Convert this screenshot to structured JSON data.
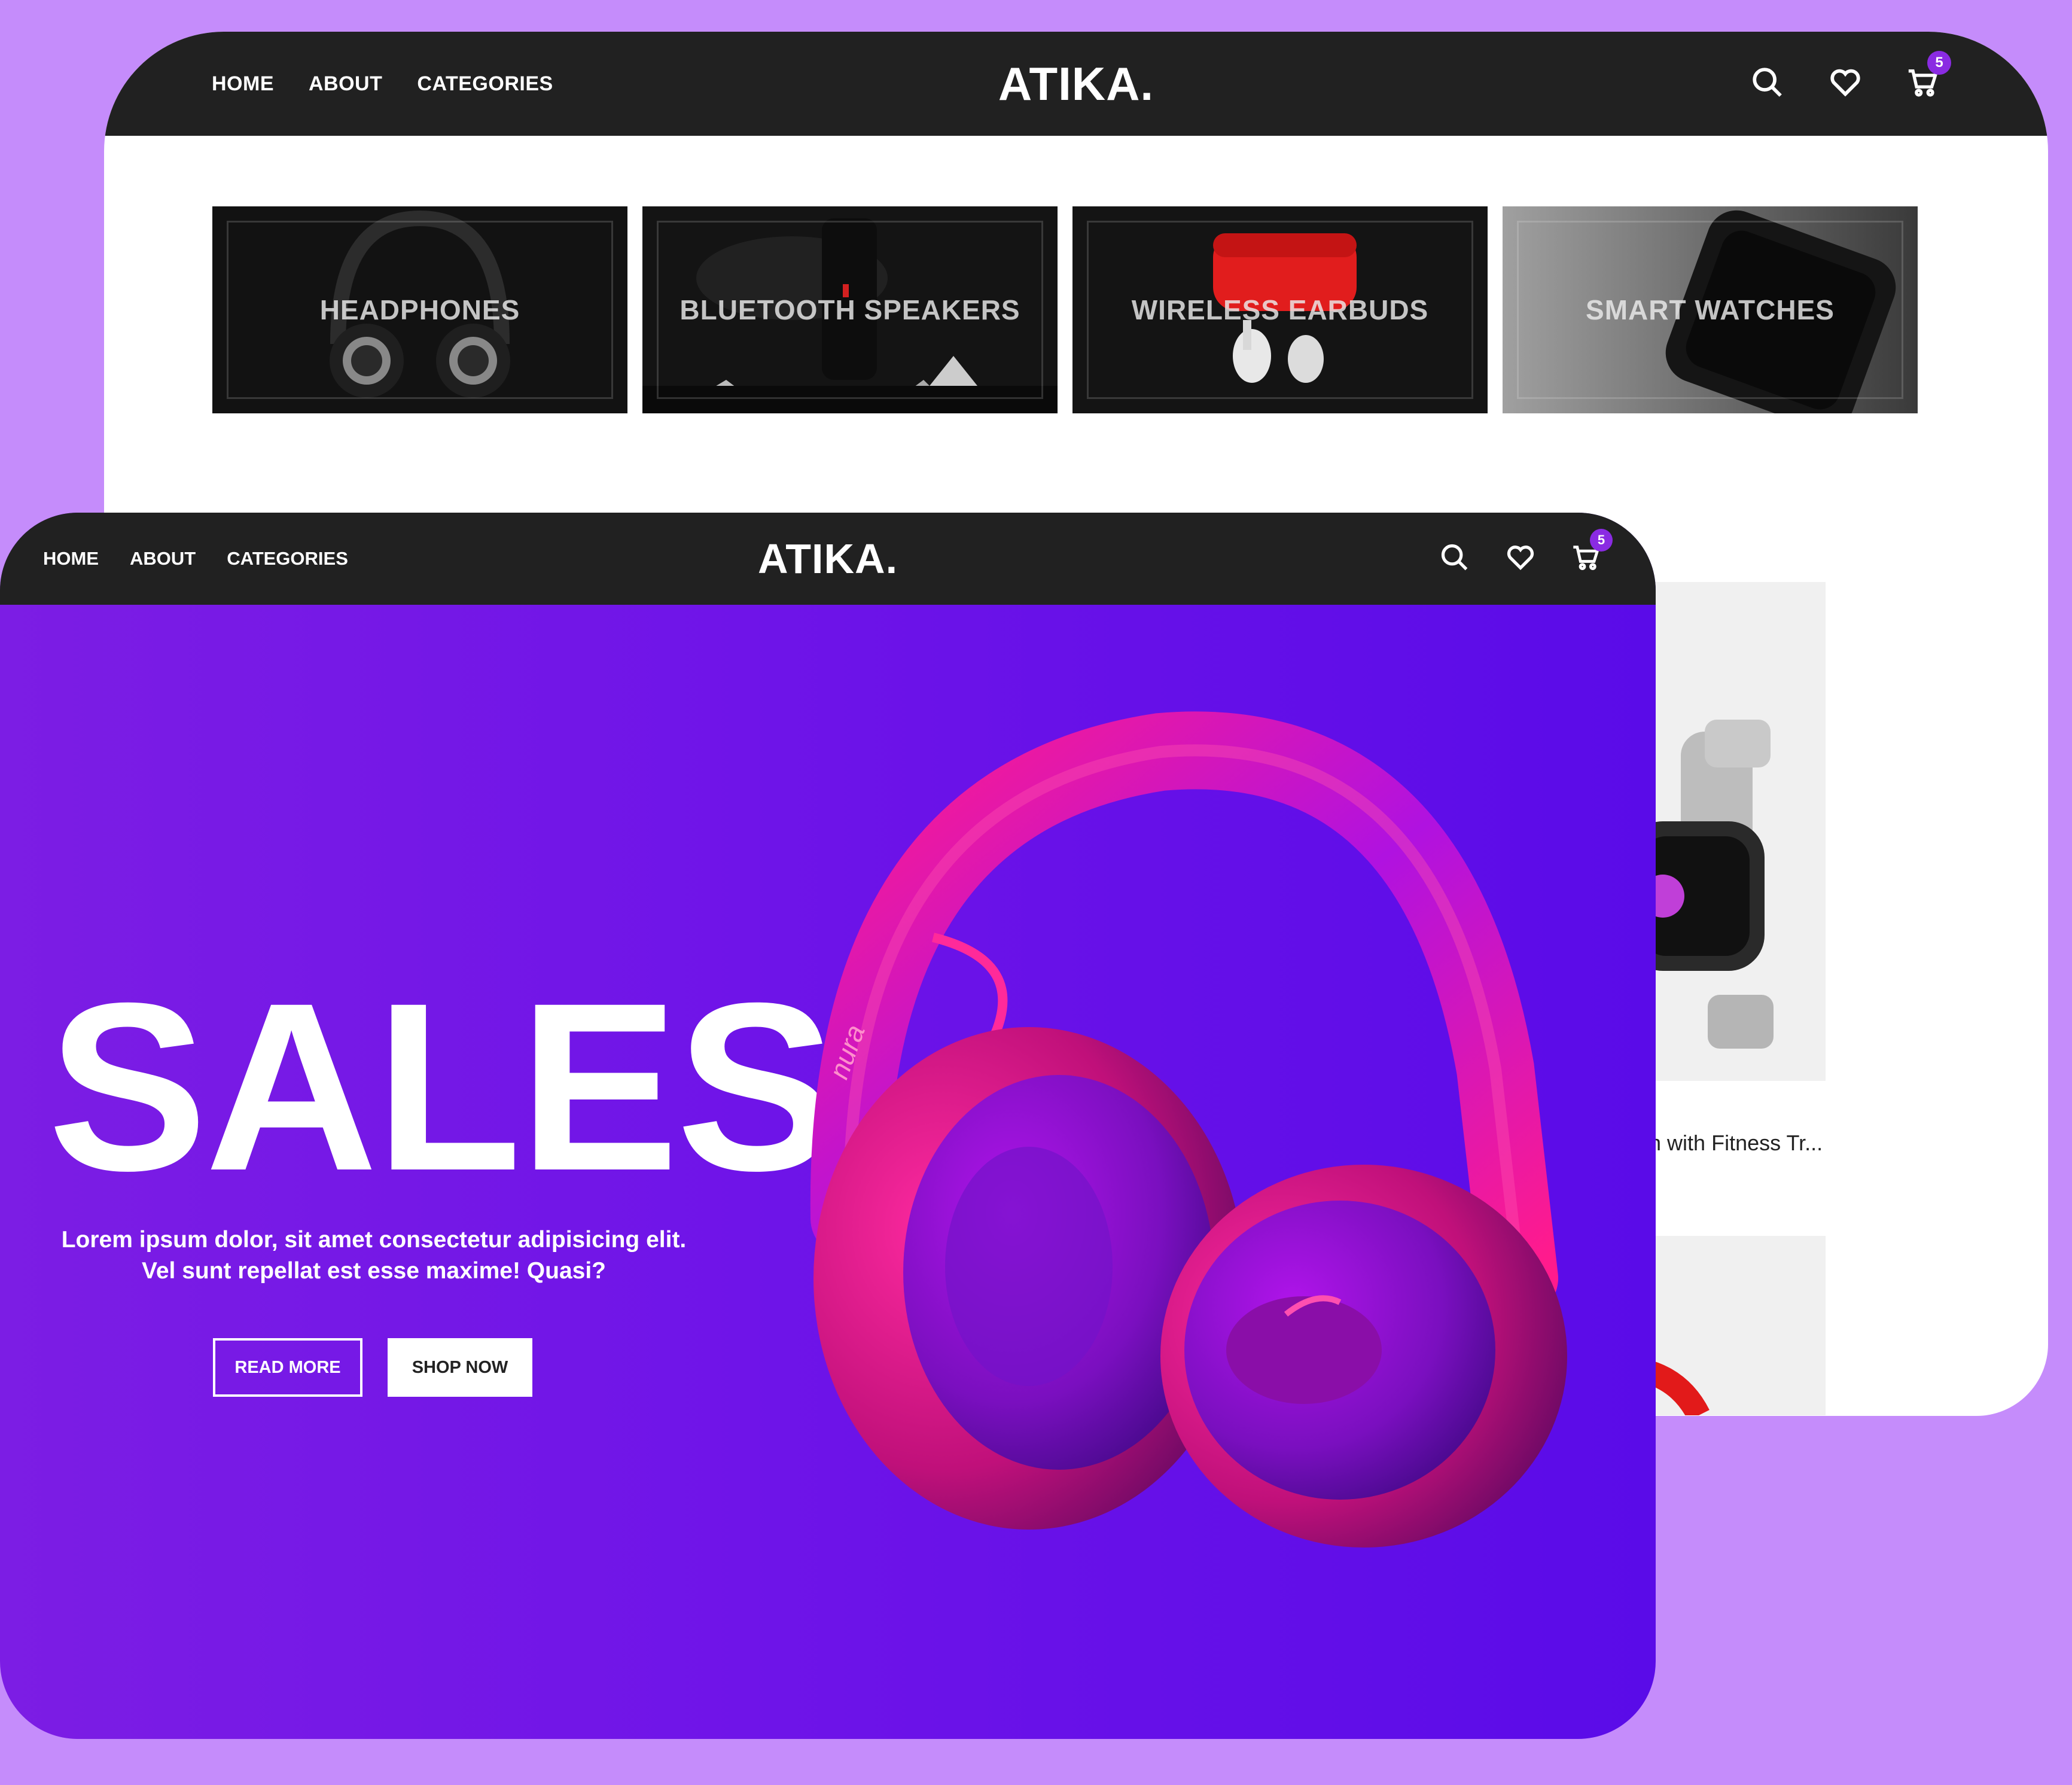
{
  "back_window": {
    "nav": {
      "home": "HOME",
      "about": "ABOUT",
      "categories": "CATEGORIES"
    },
    "brand": "ATIKA.",
    "cart_count": "5",
    "categories": [
      {
        "label": "HEADPHONES"
      },
      {
        "label": "BLUETOOTH SPEAKERS"
      },
      {
        "label": "WIRELESS EARBUDS"
      },
      {
        "label": "SMART WATCHES"
      }
    ],
    "product": {
      "title": "Smartwatch with Fitness Tr..."
    }
  },
  "front_window": {
    "nav": {
      "home": "HOME",
      "about": "ABOUT",
      "categories": "CATEGORIES"
    },
    "brand": "ATIKA.",
    "cart_count": "5",
    "hero": {
      "title": "SALES",
      "text": "Lorem ipsum dolor, sit amet consectetur adipisicing elit. Vel sunt repellat est esse maxime! Quasi?",
      "read_more": "READ MORE",
      "shop_now": "SHOP NOW",
      "product_brand": "nura"
    }
  },
  "colors": {
    "page_bg": "#c58cfb",
    "navbar": "#212121",
    "hero_purple": "#6f14e8",
    "accent_pink": "#ff1493",
    "badge": "#8a2be2"
  },
  "icons": [
    "search-icon",
    "heart-icon",
    "cart-icon"
  ]
}
